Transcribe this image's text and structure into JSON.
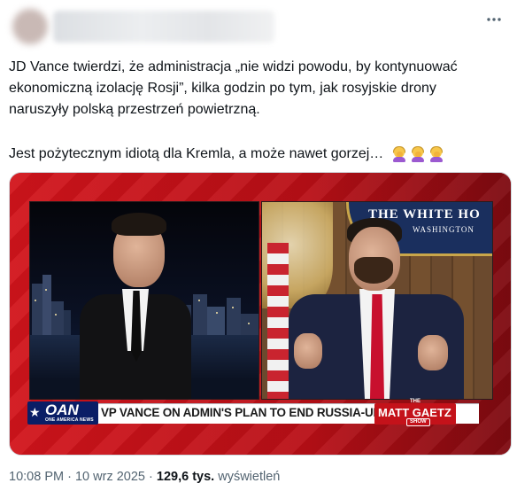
{
  "tweet": {
    "more_icon": "more-horizontal-icon",
    "text_line1": "JD Vance twierdzi, że administracja „nie widzi powodu, by kontynuować",
    "text_line2": "ekonomiczną izolację Rosji”, kilka godzin po tym, jak rosyjskie drony",
    "text_line3": "naruszyły polską przestrzeń powietrzną.",
    "text_line4": "Jest pożytecznym idiotą dla Kremla, a może nawet gorzej…",
    "emojis": [
      "woman-facepalming-emoji",
      "woman-facepalming-emoji",
      "woman-facepalming-emoji"
    ]
  },
  "media": {
    "seal_title": "THE WHITE HO",
    "seal_subtitle": "WASHINGTON",
    "network_logo": "OAN",
    "network_tagline": "ONE AMERICA NEWS",
    "ticker": "VP VANCE ON ADMIN'S PLAN TO END RUSSIA-UKRAINE WAR",
    "show_the": "THE",
    "show_name": "MATT GAETZ",
    "show_suffix": "SHOW"
  },
  "footer": {
    "time": "10:08 PM",
    "separator": "·",
    "date": "10 wrz 2025",
    "views_count": "129,6 tys.",
    "views_label": "wyświetleń"
  },
  "colors": {
    "text": "#0f1419",
    "muted": "#536471",
    "oan_blue": "#0a1e66",
    "show_red": "#c4121a"
  }
}
